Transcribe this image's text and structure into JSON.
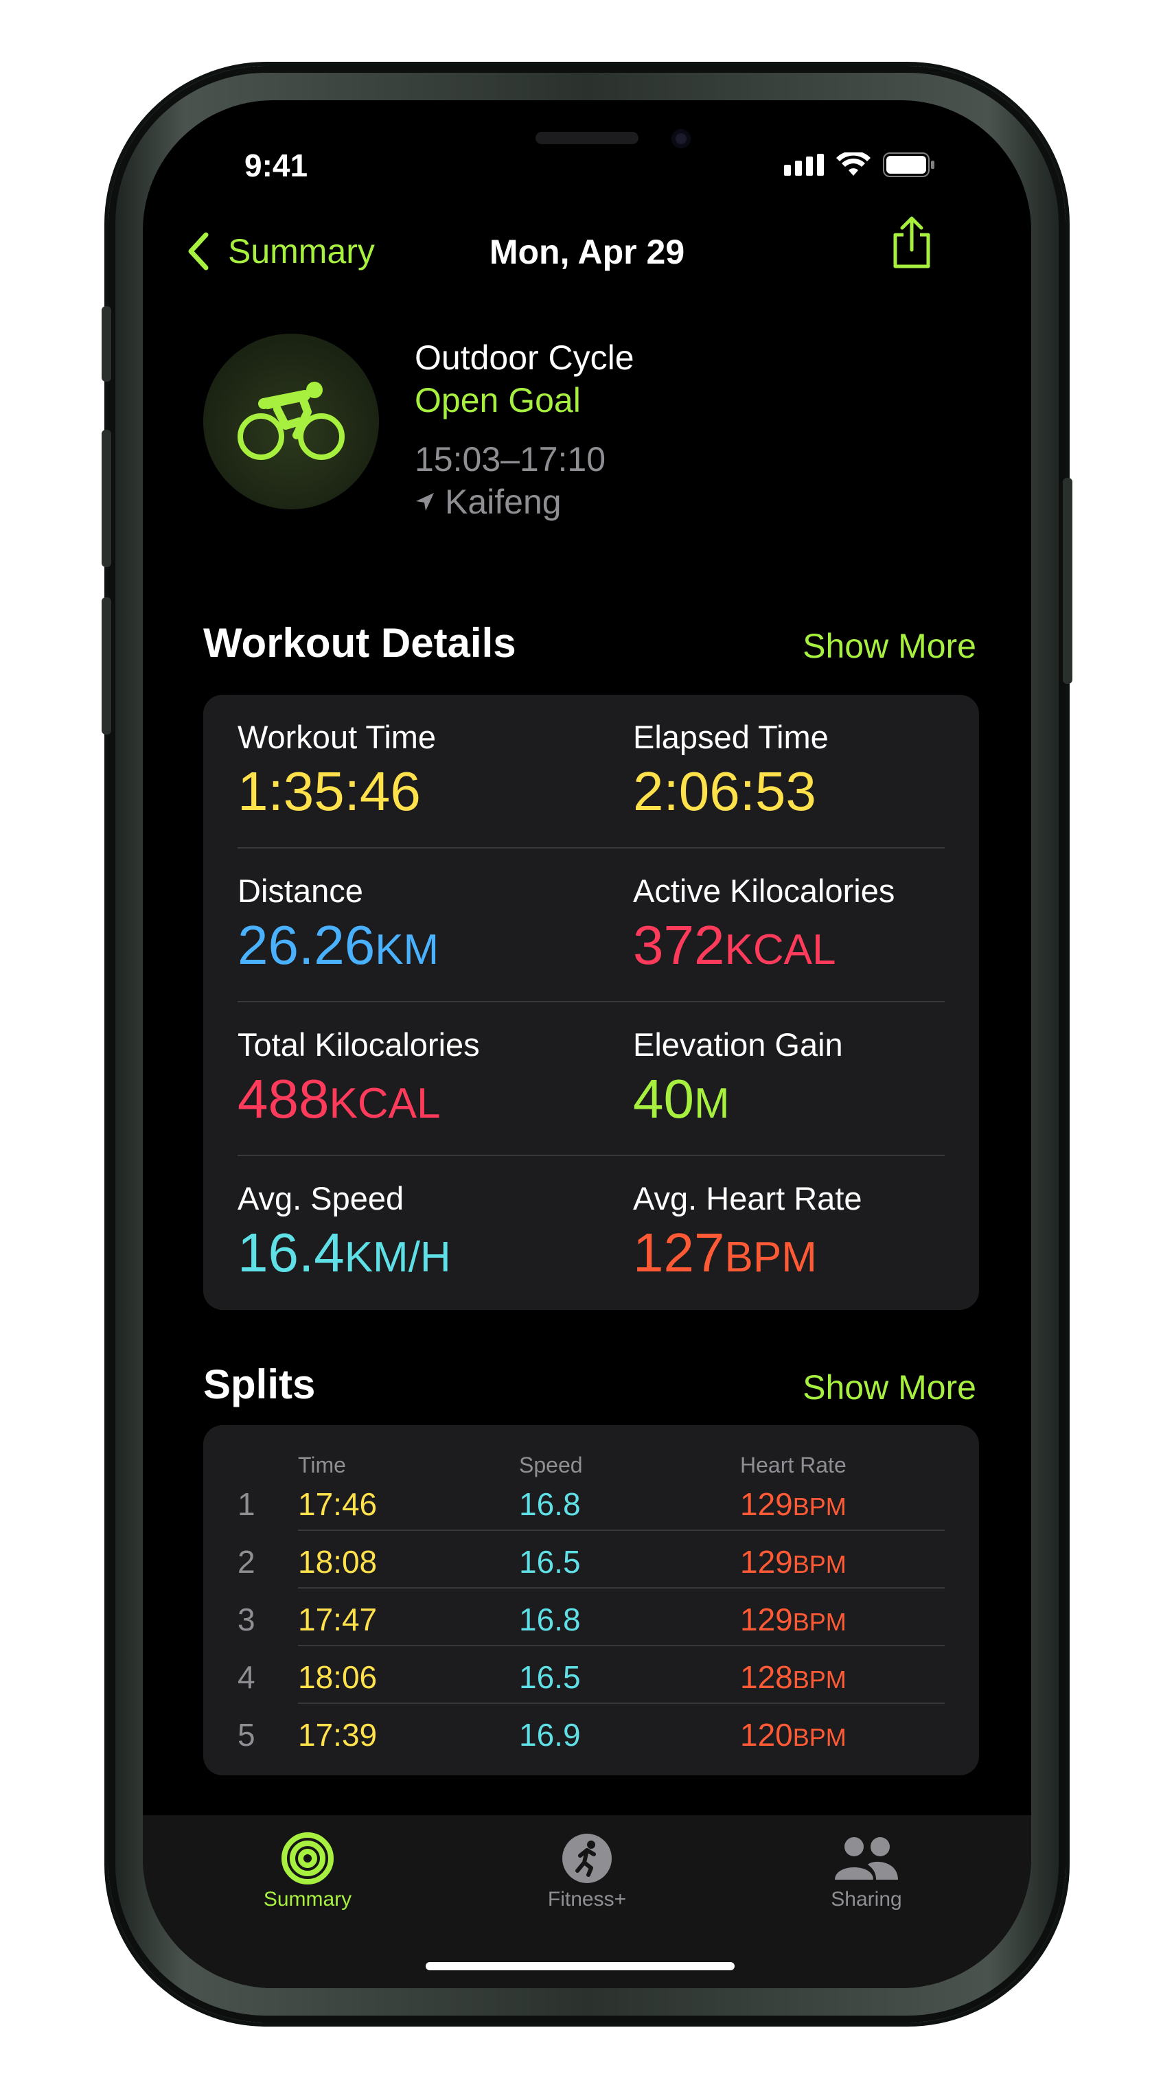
{
  "status": {
    "time": "9:41"
  },
  "nav": {
    "back_label": "Summary",
    "title": "Mon, Apr 29"
  },
  "workout": {
    "type": "Outdoor Cycle",
    "goal": "Open Goal",
    "time_range": "15:03–17:10",
    "location": "Kaifeng"
  },
  "details": {
    "title": "Workout Details",
    "show_more": "Show More",
    "items": [
      {
        "label": "Workout Time",
        "value": "1:35:46",
        "unit": "",
        "color": "#ffe14c"
      },
      {
        "label": "Elapsed Time",
        "value": "2:06:53",
        "unit": "",
        "color": "#ffe14c"
      },
      {
        "label": "Distance",
        "value": "26.26",
        "unit": "KM",
        "color": "#4ab1ff"
      },
      {
        "label": "Active Kilocalories",
        "value": "372",
        "unit": "KCAL",
        "color": "#ff3b5c"
      },
      {
        "label": "Total Kilocalories",
        "value": "488",
        "unit": "KCAL",
        "color": "#ff3b5c"
      },
      {
        "label": "Elevation Gain",
        "value": "40",
        "unit": "M",
        "color": "#a7f03f"
      },
      {
        "label": "Avg. Speed",
        "value": "16.4",
        "unit": "KM/H",
        "color": "#5ee0e6"
      },
      {
        "label": "Avg. Heart Rate",
        "value": "127",
        "unit": "BPM",
        "color": "#ff5a36"
      }
    ]
  },
  "splits": {
    "title": "Splits",
    "show_more": "Show More",
    "columns": [
      "Time",
      "Speed",
      "Heart Rate"
    ],
    "hr_unit": "BPM",
    "rows": [
      {
        "index": "1",
        "time": "17:46",
        "speed": "16.8",
        "hr": "129"
      },
      {
        "index": "2",
        "time": "18:08",
        "speed": "16.5",
        "hr": "129"
      },
      {
        "index": "3",
        "time": "17:47",
        "speed": "16.8",
        "hr": "129"
      },
      {
        "index": "4",
        "time": "18:06",
        "speed": "16.5",
        "hr": "128"
      },
      {
        "index": "5",
        "time": "17:39",
        "speed": "16.9",
        "hr": "120"
      }
    ]
  },
  "tabs": [
    {
      "label": "Summary",
      "icon": "activity-rings-icon",
      "active": true
    },
    {
      "label": "Fitness+",
      "icon": "fitness-runner-icon",
      "active": false
    },
    {
      "label": "Sharing",
      "icon": "sharing-people-icon",
      "active": false
    }
  ],
  "colors": {
    "accent": "#a7f03f",
    "background": "#000000",
    "card": "#1c1c1e"
  }
}
